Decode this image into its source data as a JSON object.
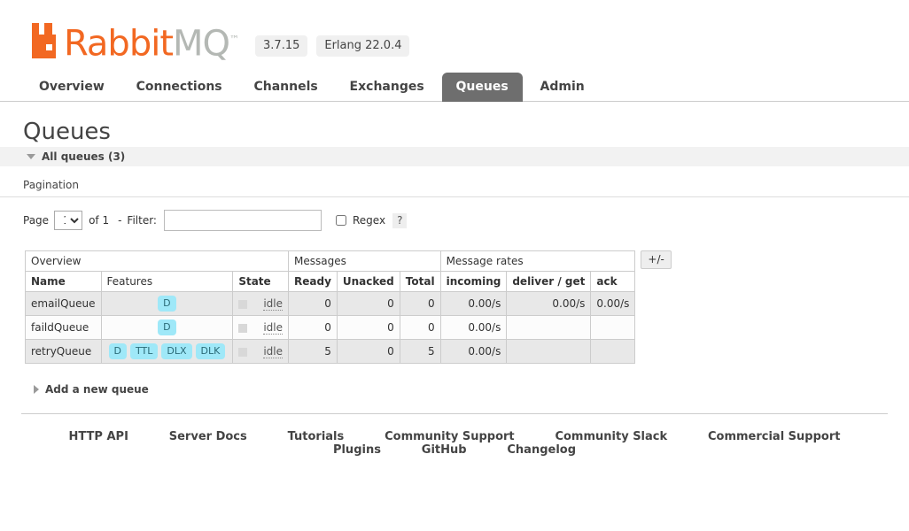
{
  "header": {
    "logo_name": "RabbitMQ",
    "logo_part_1": "Rabbit",
    "logo_part_2": "MQ",
    "trademark": "™",
    "version": "3.7.15",
    "erlang_version": "Erlang 22.0.4",
    "brand_orange": "#f26822",
    "brand_gray": "#b4b8b4"
  },
  "nav": {
    "tabs": [
      {
        "label": "Overview",
        "selected": false
      },
      {
        "label": "Connections",
        "selected": false
      },
      {
        "label": "Channels",
        "selected": false
      },
      {
        "label": "Exchanges",
        "selected": false
      },
      {
        "label": "Queues",
        "selected": true
      },
      {
        "label": "Admin",
        "selected": false
      }
    ]
  },
  "page": {
    "title": "Queues",
    "section_title": "All queues (3)",
    "pagination_label": "Pagination",
    "add_queue_label": "Add a new queue"
  },
  "filter": {
    "page_label": "Page",
    "page_value": "1",
    "page_options": [
      "1"
    ],
    "of_label": "of 1",
    "filter_dash": "-",
    "filter_label": "Filter:",
    "filter_value": "",
    "filter_placeholder": "",
    "regex_label": "Regex",
    "regex_checked": false,
    "help_label": "?"
  },
  "table": {
    "group_headers": [
      {
        "label": "Overview",
        "span": 3
      },
      {
        "label": "Messages",
        "span": 3
      },
      {
        "label": "Message rates",
        "span": 3
      }
    ],
    "columns": [
      {
        "label": "Name",
        "bold": true,
        "align": "left"
      },
      {
        "label": "Features",
        "bold": false,
        "align": "left"
      },
      {
        "label": "State",
        "bold": true,
        "align": "left"
      },
      {
        "label": "Ready",
        "bold": true,
        "align": "left"
      },
      {
        "label": "Unacked",
        "bold": true,
        "align": "left"
      },
      {
        "label": "Total",
        "bold": true,
        "align": "left"
      },
      {
        "label": "incoming",
        "bold": true,
        "align": "left"
      },
      {
        "label": "deliver / get",
        "bold": true,
        "align": "left"
      },
      {
        "label": "ack",
        "bold": true,
        "align": "left"
      }
    ],
    "toggle_columns_label": "+/-",
    "rows": [
      {
        "name": "emailQueue",
        "features": [
          "D"
        ],
        "features_align": "center",
        "state": "idle",
        "ready": "0",
        "unacked": "0",
        "total": "0",
        "incoming": "0.00/s",
        "deliver_get": "0.00/s",
        "ack": "0.00/s"
      },
      {
        "name": "faildQueue",
        "features": [
          "D"
        ],
        "features_align": "center",
        "state": "idle",
        "ready": "0",
        "unacked": "0",
        "total": "0",
        "incoming": "0.00/s",
        "deliver_get": "",
        "ack": ""
      },
      {
        "name": "retryQueue",
        "features": [
          "D",
          "TTL",
          "DLX",
          "DLK"
        ],
        "features_align": "left",
        "state": "idle",
        "ready": "5",
        "unacked": "0",
        "total": "5",
        "incoming": "0.00/s",
        "deliver_get": "",
        "ack": ""
      }
    ],
    "badge_color": "#9fe8f8"
  },
  "footer": {
    "links": [
      "HTTP API",
      "Server Docs",
      "Tutorials",
      "Community Support",
      "Community Slack",
      "Commercial Support",
      "Plugins",
      "GitHub",
      "Changelog"
    ]
  }
}
